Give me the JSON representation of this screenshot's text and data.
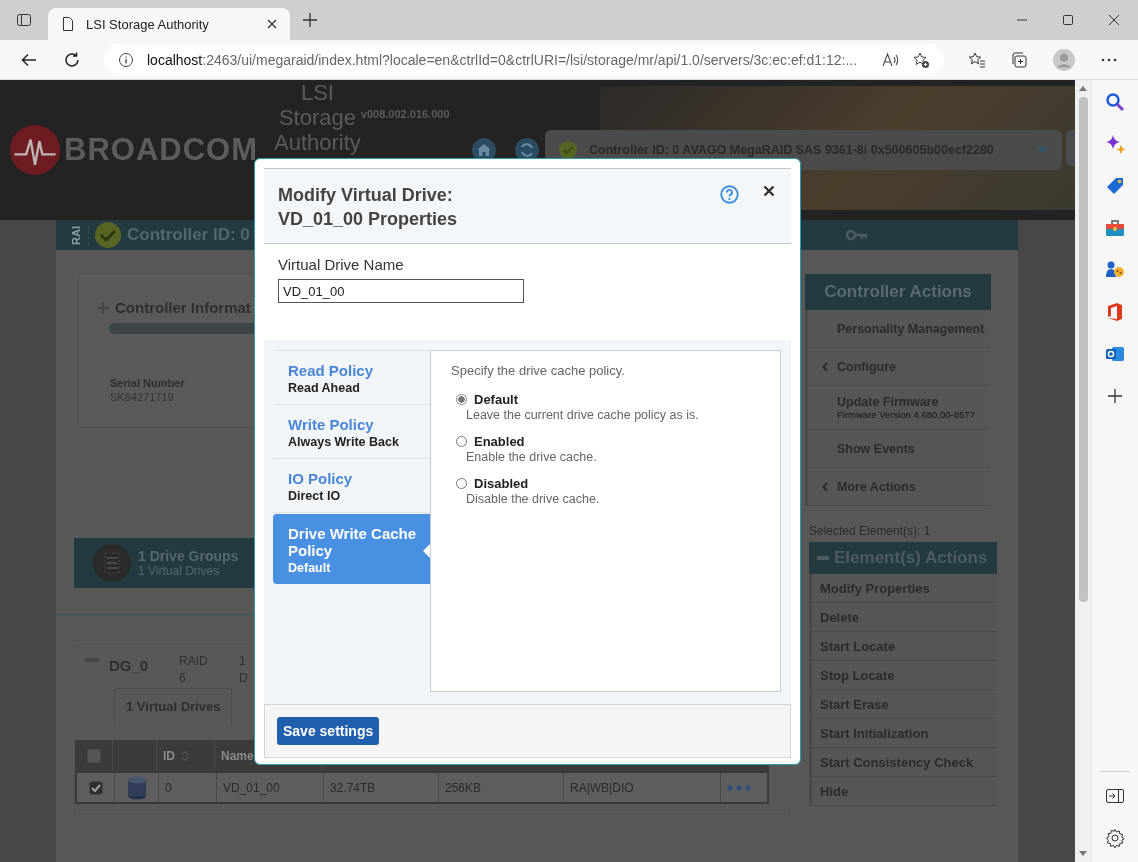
{
  "browser": {
    "tab_title": "LSI Storage Authority",
    "url_host": "localhost",
    "url_rest": ":2463/ui/megaraid/index.html?locale=en&ctrlId=0&ctrlURI=/lsi/storage/mr/api/1.0/servers/3c:ec:ef:d1:12:..."
  },
  "app_header": {
    "brand": "BROADCOM",
    "product_lines": [
      "LSI",
      "Storage",
      "Authority"
    ],
    "version": "v008.002.016.000",
    "controller_select": "Controller ID: 0 AVAGO MegaRAID SAS 9361-8i 0x500605b00ecf2280"
  },
  "controller_bar": {
    "side_label": "RAI",
    "title": "Controller ID: 0"
  },
  "controller_info": {
    "title": "Controller Informat",
    "field_label": "Serial Number",
    "field_value": "SK84271719"
  },
  "drive_groups_summary": {
    "groups": "1 Drive Groups",
    "virtual_drives": "1 Virtual Drives"
  },
  "drive_group": {
    "name": "DG_0",
    "raid_label": "RAID",
    "raid_level": "6",
    "column_3": [
      "1",
      "D"
    ],
    "tab": "1 Virtual Drives",
    "table": {
      "columns": [
        "ID",
        "Name"
      ],
      "select_all": {
        "checked": false
      },
      "rows": [
        {
          "selected": true,
          "cells": [
            "0",
            "VD_01_00",
            "32.74TB",
            "256KB",
            "RA|WB|DIO"
          ]
        }
      ]
    }
  },
  "controller_actions": {
    "title": "Controller Actions",
    "items": [
      {
        "label": "Personality Management",
        "expandable": false
      },
      {
        "label": "Configure",
        "expandable": true
      },
      {
        "label": "Update Firmware",
        "sub": "Firmware Version 4.680.00-8577",
        "expandable": false
      },
      {
        "label": "Show Events",
        "expandable": false
      },
      {
        "label": "More Actions",
        "expandable": true
      }
    ]
  },
  "selection_count": "Selected Element(s): 1",
  "element_actions": {
    "title": "Element(s) Actions",
    "items": [
      "Modify Properties",
      "Delete",
      "Start Locate",
      "Stop Locate",
      "Start Erase",
      "Start Initialization",
      "Start Consistency Check",
      "Hide"
    ]
  },
  "dialog": {
    "title_lines": [
      "Modify Virtual Drive:",
      "VD_01_00 Properties"
    ],
    "name_label": "Virtual Drive Name",
    "name_value": "VD_01_00",
    "policies": [
      {
        "title": "Read Policy",
        "value": "Read Ahead",
        "selected": false
      },
      {
        "title": "Write Policy",
        "value": "Always Write Back",
        "selected": false
      },
      {
        "title": "IO Policy",
        "value": "Direct IO",
        "selected": false
      },
      {
        "title": "Drive Write Cache Policy",
        "value": "Default",
        "selected": true
      }
    ],
    "panel_description": "Specify the drive cache policy.",
    "options": [
      {
        "label": "Default",
        "description": "Leave the current drive cache policy as is.",
        "selected": true
      },
      {
        "label": "Enabled",
        "description": "Enable the drive cache.",
        "selected": false
      },
      {
        "label": "Disabled",
        "description": "Disable the drive cache.",
        "selected": false
      }
    ],
    "save_button": "Save settings"
  }
}
